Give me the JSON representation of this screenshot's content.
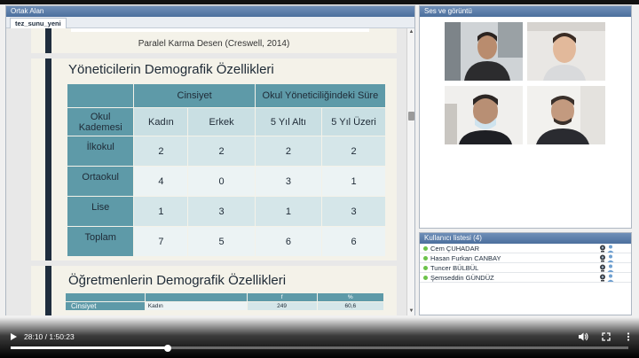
{
  "shared_area": {
    "title": "Ortak Alan",
    "tab": "tez_sunu_yeni"
  },
  "slides": {
    "prev_caption": "Paralel Karma Desen (Creswell, 2014)",
    "main": {
      "title": "Yöneticilerin Demografik Özellikleri",
      "group_headers": [
        "Cinsiyet",
        "Okul Yöneticiliğindeki Süre"
      ],
      "corner_label": "Okul Kademesi",
      "column_labels": [
        "Kadın",
        "Erkek",
        "5 Yıl Altı",
        "5 Yıl Üzeri"
      ],
      "rows": [
        {
          "label": "İlkokul",
          "values": [
            "2",
            "2",
            "2",
            "2"
          ]
        },
        {
          "label": "Ortaokul",
          "values": [
            "4",
            "0",
            "3",
            "1"
          ]
        },
        {
          "label": "Lise",
          "values": [
            "1",
            "3",
            "1",
            "3"
          ]
        },
        {
          "label": "Toplam",
          "values": [
            "7",
            "5",
            "6",
            "6"
          ]
        }
      ]
    },
    "next": {
      "title": "Öğretmenlerin Demografik Özellikleri",
      "header_cells": [
        "",
        "",
        "f",
        "%"
      ],
      "row_label": "Cinsiyet",
      "row_sub": "Kadın",
      "row_values": [
        "249",
        "60,6"
      ]
    }
  },
  "audio_video": {
    "title": "Ses ve görüntü"
  },
  "user_list": {
    "title": "Kullanıcı listesi (4)",
    "users": [
      "Cem ÇUHADAR",
      "Hasan Furkan CANBAY",
      "Tuncer BÜLBÜL",
      "Şemseddin GÜNDÜZ"
    ]
  },
  "player": {
    "current_time": "28:10",
    "duration": "1:50:23",
    "progress_fraction": 0.255
  },
  "colors": {
    "header_blue": "#4b6f9d",
    "table_teal": "#5e9aa8",
    "slide_bar": "#1f2d3d",
    "online_dot": "#6cc24a"
  }
}
